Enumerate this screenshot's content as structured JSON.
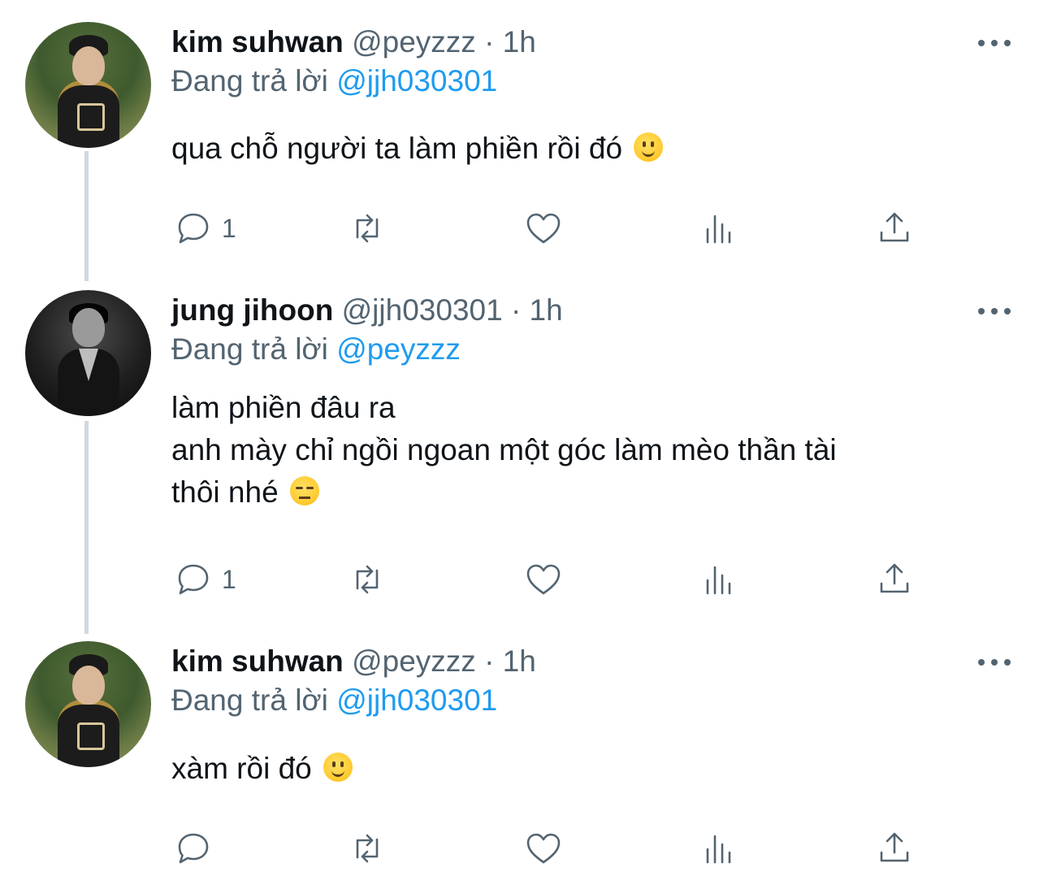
{
  "tweets": [
    {
      "display_name": "kim suhwan",
      "handle": "@peyzzz",
      "separator": "·",
      "time": "1h",
      "replying_prefix": "Đang trả lời",
      "replying_to": "@jjh030301",
      "text": "qua chỗ người ta làm phiền rồi đó",
      "emoji": "slightly-smiling-face",
      "reply_count": "1",
      "avatar": "kim-suhwan-avatar"
    },
    {
      "display_name": "jung jihoon",
      "handle": "@jjh030301",
      "separator": "·",
      "time": "1h",
      "replying_prefix": "Đang trả lời",
      "replying_to": "@peyzzz",
      "text": "làm phiền đâu ra\nanh mày chỉ ngồi ngoan một góc làm mèo thần tài\nthôi nhé",
      "emoji": "unamused-face",
      "reply_count": "1",
      "avatar": "jung-jihoon-avatar"
    },
    {
      "display_name": "kim suhwan",
      "handle": "@peyzzz",
      "separator": "·",
      "time": "1h",
      "replying_prefix": "Đang trả lời",
      "replying_to": "@jjh030301",
      "text": "xàm rồi đó",
      "emoji": "slightly-smiling-face",
      "reply_count": "",
      "avatar": "kim-suhwan-avatar"
    }
  ],
  "icons": {
    "reply": "reply-icon",
    "retweet": "retweet-icon",
    "like": "heart-icon",
    "views": "views-icon",
    "share": "share-icon",
    "more": "more-icon"
  },
  "colors": {
    "text": "#0f1419",
    "secondary": "#536471",
    "mention": "#1d9bf0",
    "thread_line": "#cfd9de"
  }
}
